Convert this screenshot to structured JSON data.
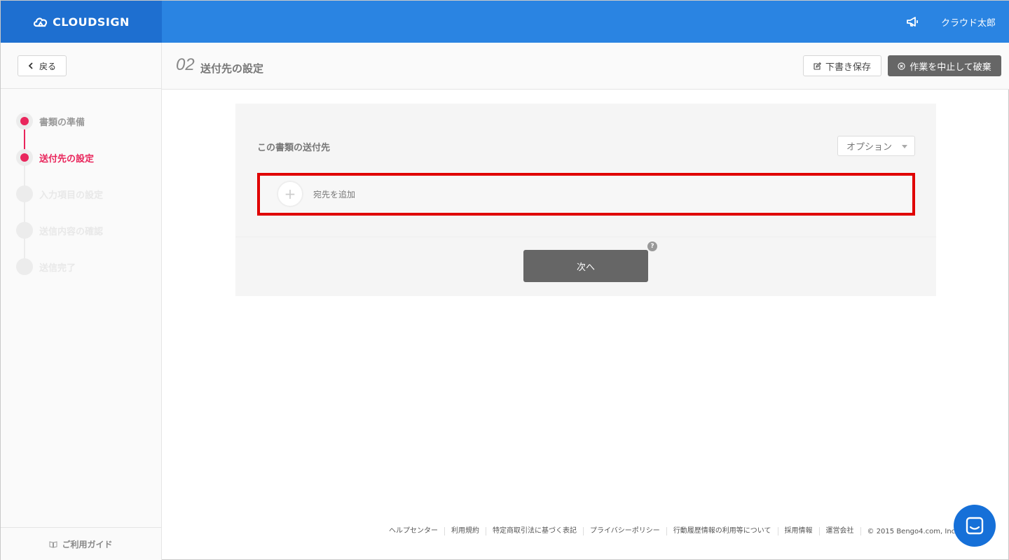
{
  "header": {
    "logo_text": "CLOUDSIGN",
    "user_name": "クラウド太郎"
  },
  "sidebar": {
    "back_label": "戻る",
    "steps": [
      {
        "label": "書類の準備",
        "state": "done"
      },
      {
        "label": "送付先の設定",
        "state": "current"
      },
      {
        "label": "入力項目の設定",
        "state": "future"
      },
      {
        "label": "送信内容の確認",
        "state": "future"
      },
      {
        "label": "送信完了",
        "state": "future"
      }
    ],
    "guide_label": "ご利用ガイド"
  },
  "titlebar": {
    "step_number": "02",
    "title": "送付先の設定",
    "draft_label": "下書き保存",
    "abort_label": "作業を中止して破棄"
  },
  "panel": {
    "heading": "この書類の送付先",
    "option_label": "オプション",
    "add_label": "宛先を追加",
    "next_label": "次へ",
    "help_mark": "?"
  },
  "footer": {
    "links": [
      "ヘルプセンター",
      "利用規約",
      "特定商取引法に基づく表記",
      "プライバシーポリシー",
      "行動履歴情報の利用等について",
      "採用情報",
      "運営会社"
    ],
    "copyright": "© 2015 Bengo4.com, Inc."
  },
  "colors": {
    "brand_blue": "#2a84e2",
    "accent_pink": "#e9265c",
    "highlight_red": "#e00000"
  }
}
